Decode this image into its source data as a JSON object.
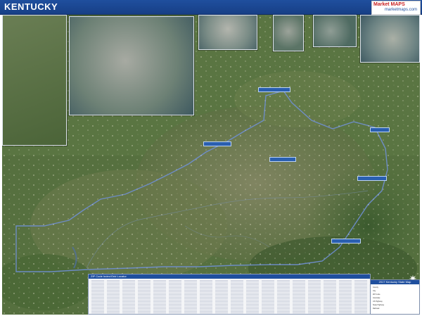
{
  "header": {
    "title": "KENTUCKY",
    "logo_text": "Market MAPS",
    "logo_sub": "marketmaps.com"
  },
  "insets": [
    {
      "id": "inset-large-left",
      "label": ""
    },
    {
      "id": "inset-top-1",
      "label": ""
    },
    {
      "id": "inset-top-2",
      "label": ""
    },
    {
      "id": "inset-top-3",
      "label": ""
    },
    {
      "id": "inset-top-4",
      "label": ""
    },
    {
      "id": "inset-top-5",
      "label": ""
    }
  ],
  "zip_index": {
    "title": "ZIP Code Index/Grid Locator"
  },
  "legend": {
    "title": "2017 Kentucky State Map",
    "rows": [
      "County",
      "City",
      "ZIP Code",
      "Interstate",
      "US Highway",
      "State Highway",
      "Railroad"
    ]
  },
  "colors": {
    "title_bar": "#1f4f9e",
    "state_border": "#6f8fd4",
    "terrain_dark": "#3f5a32",
    "terrain_light": "#8a8a66"
  },
  "icons": {
    "compass": "north-arrow-icon"
  }
}
